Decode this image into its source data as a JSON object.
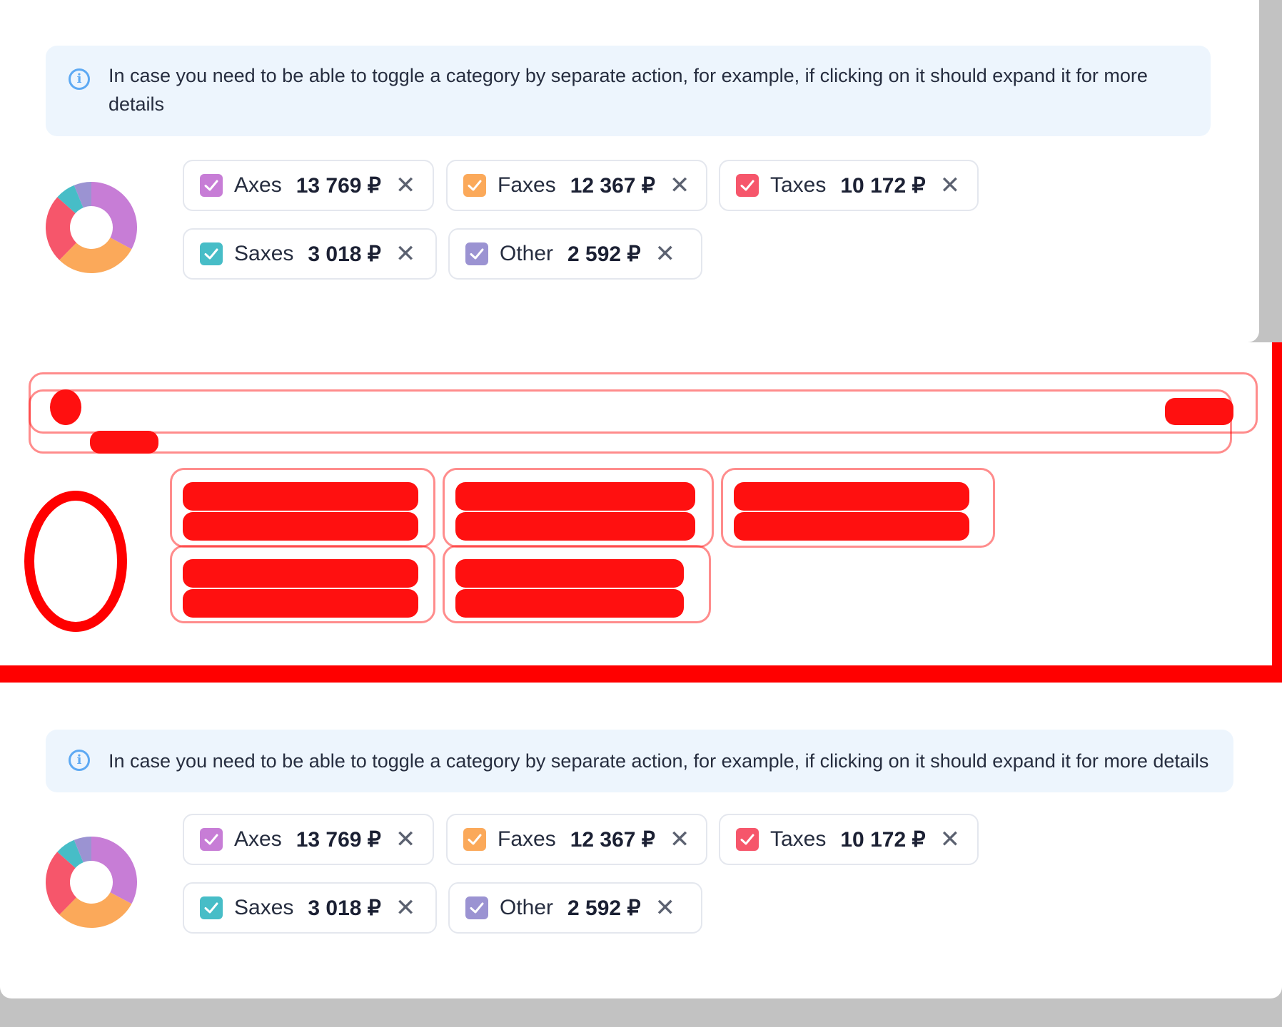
{
  "info_text": "In case you need to be able to toggle a category by separate action, for example, if clicking on it should expand it for more details",
  "categories": [
    {
      "label": "Axes",
      "value": "13 769 ₽",
      "color": "#c77dd6"
    },
    {
      "label": "Faxes",
      "value": "12 367 ₽",
      "color": "#fba95a"
    },
    {
      "label": "Taxes",
      "value": "10 172 ₽",
      "color": "#f6566b"
    },
    {
      "label": "Saxes",
      "value": "3 018 ₽",
      "color": "#47bdc7"
    },
    {
      "label": "Other",
      "value": "2 592 ₽",
      "color": "#9b93d2"
    }
  ],
  "chart_data": {
    "type": "pie",
    "categories": [
      "Axes",
      "Faxes",
      "Taxes",
      "Saxes",
      "Other"
    ],
    "values": [
      13769,
      12367,
      10172,
      3018,
      2592
    ]
  },
  "colors": {
    "info_bg": "#edf5fd",
    "info_icon": "#5da9f3",
    "diff_red": "#ff0000"
  },
  "icons": {
    "info": "info-circle-icon",
    "check": "checkmark-icon",
    "remove": "close-icon"
  }
}
